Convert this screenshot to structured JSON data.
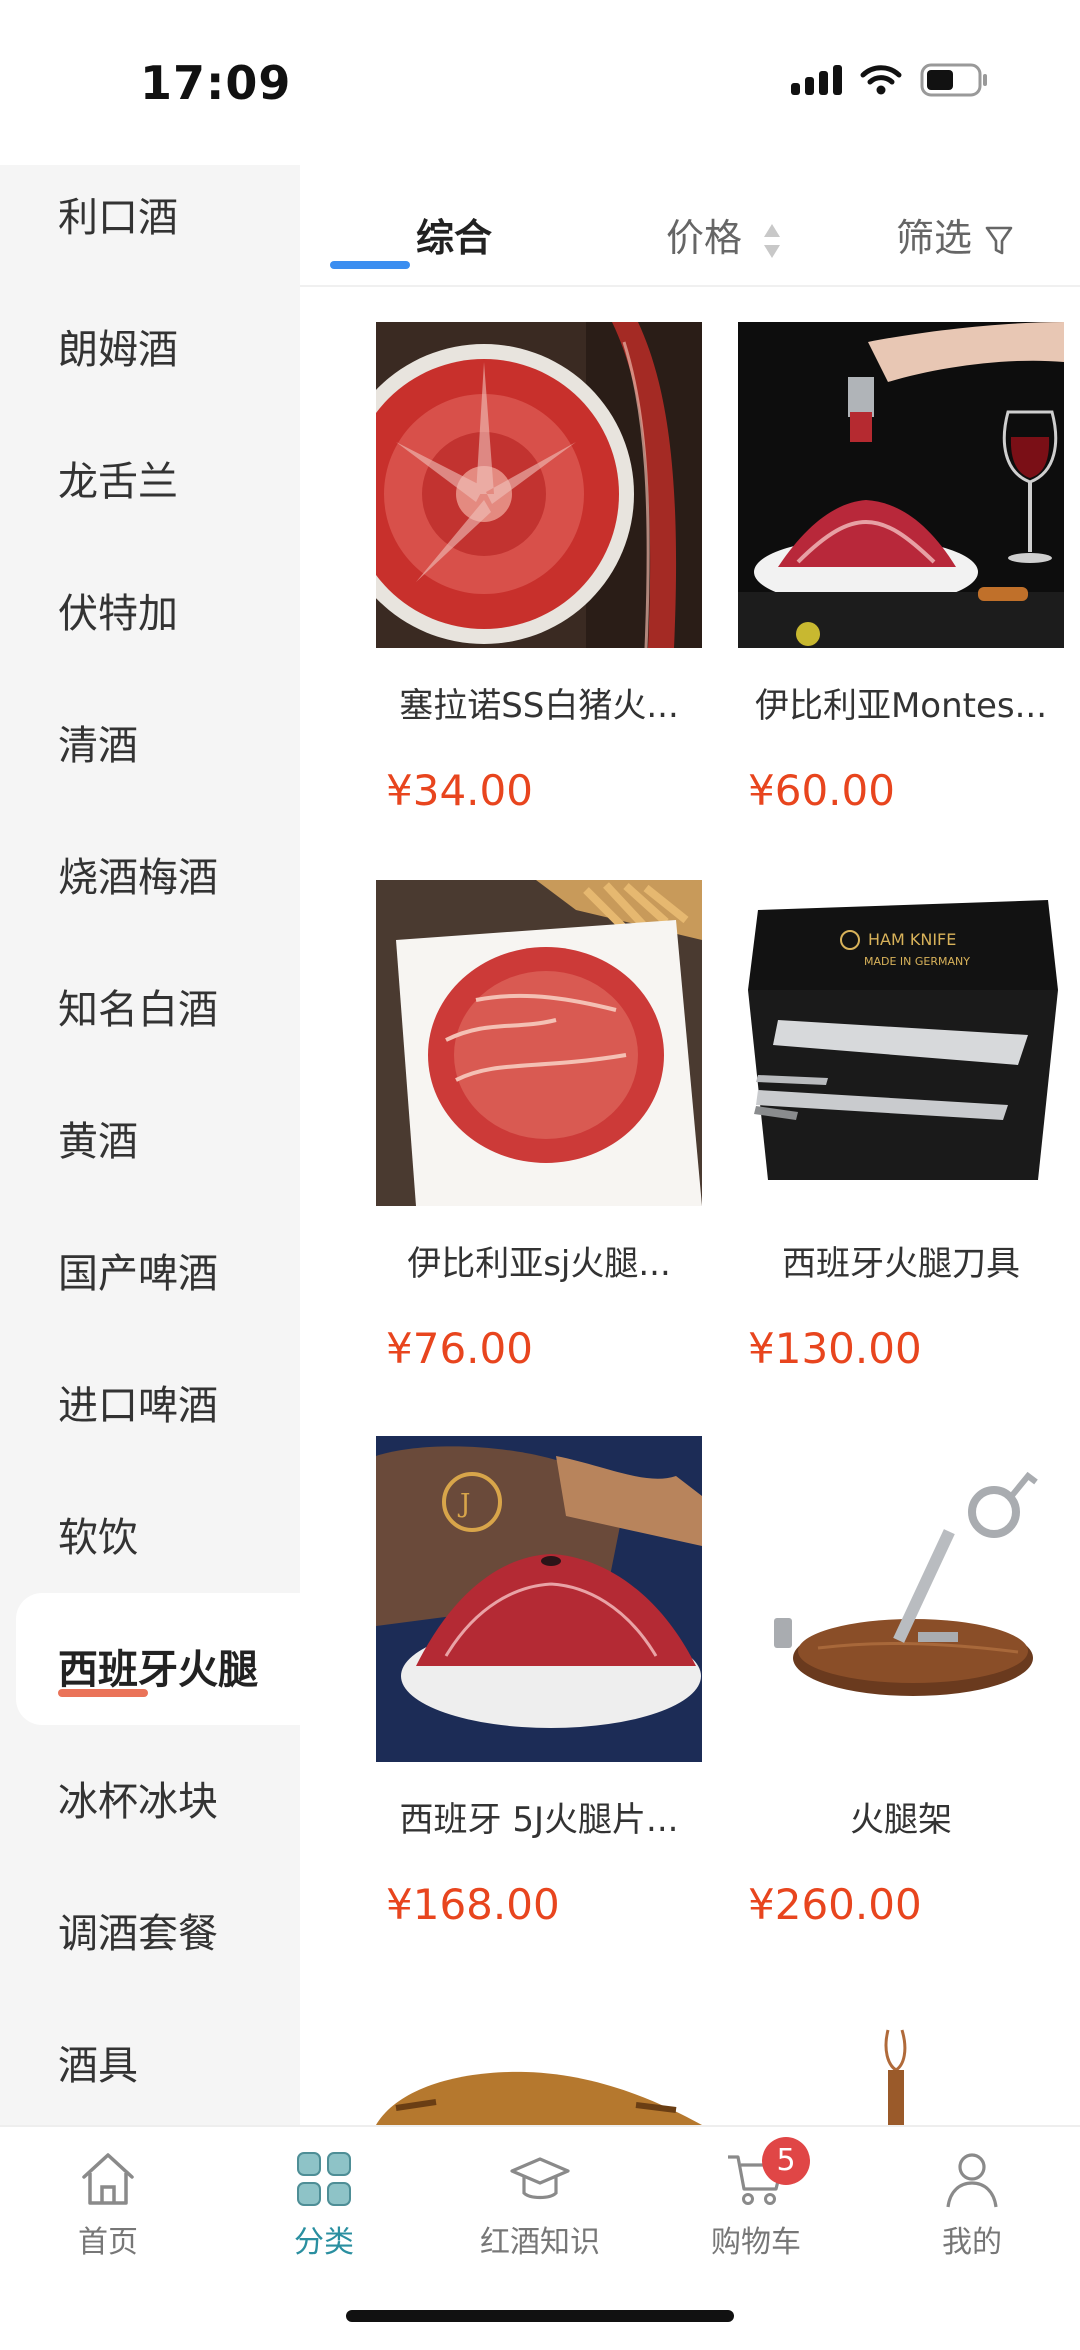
{
  "status_bar": {
    "time": "17:09"
  },
  "sidebar": {
    "items": [
      {
        "label": "利口酒"
      },
      {
        "label": "朗姆酒"
      },
      {
        "label": "龙舌兰"
      },
      {
        "label": "伏特加"
      },
      {
        "label": "清酒"
      },
      {
        "label": "烧酒梅酒"
      },
      {
        "label": "知名白酒"
      },
      {
        "label": "黄酒"
      },
      {
        "label": "国产啤酒"
      },
      {
        "label": "进口啤酒"
      },
      {
        "label": "软饮"
      },
      {
        "label": "西班牙火腿",
        "active": true
      },
      {
        "label": "冰杯冰块"
      },
      {
        "label": "调酒套餐"
      },
      {
        "label": "酒具"
      }
    ]
  },
  "sort_bar": {
    "tabs": [
      {
        "label": "综合",
        "active": true
      },
      {
        "label": "价格"
      },
      {
        "label": "筛选"
      }
    ]
  },
  "products": [
    {
      "name": "塞拉诺SS白猪火...",
      "price": "¥34.00",
      "image": "sliced-ham-plate-with-leg"
    },
    {
      "name": "伊比利亚Montes...",
      "price": "¥60.00",
      "image": "ham-mound-dark-background"
    },
    {
      "name": "伊比利亚sj火腿...",
      "price": "¥76.00",
      "image": "ham-slices-white-plate"
    },
    {
      "name": "西班牙火腿刀具",
      "price": "¥130.00",
      "image": "ham-knife-set-box",
      "box_text": [
        "HAM KNIFE",
        "MADE IN GERMANY"
      ]
    },
    {
      "name": "西班牙 5J火腿片...",
      "price": "¥168.00",
      "image": "ham-slices-navy-bag"
    },
    {
      "name": "火腿架",
      "price": "¥260.00",
      "image": "wooden-ham-stand"
    }
  ],
  "tab_bar": {
    "tabs": [
      {
        "label": "首页",
        "icon": "home-icon"
      },
      {
        "label": "分类",
        "icon": "grid-icon",
        "active": true
      },
      {
        "label": "红酒知识",
        "icon": "graduation-cap-icon"
      },
      {
        "label": "购物车",
        "icon": "cart-icon",
        "badge": "5"
      },
      {
        "label": "我的",
        "icon": "user-icon"
      }
    ]
  },
  "colors": {
    "price": "#e8451e",
    "sort_underline": "#3b8ef0",
    "active_tab": "#2a8fa0",
    "badge": "#e04646"
  }
}
